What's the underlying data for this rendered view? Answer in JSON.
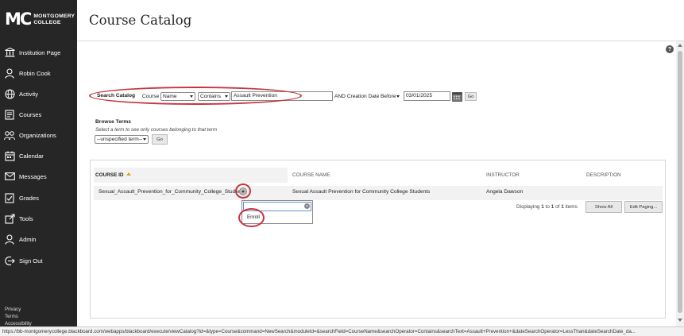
{
  "sidebar": {
    "logo_mark": "MC",
    "logo_line1": "MONTGOMERY",
    "logo_line2": "COLLEGE",
    "items": [
      {
        "label": "Institution Page",
        "icon": "institution-icon"
      },
      {
        "label": "Robin Cook",
        "icon": "user-icon"
      },
      {
        "label": "Activity",
        "icon": "globe-icon"
      },
      {
        "label": "Courses",
        "icon": "courses-icon"
      },
      {
        "label": "Organizations",
        "icon": "organizations-icon"
      },
      {
        "label": "Calendar",
        "icon": "calendar-icon"
      },
      {
        "label": "Messages",
        "icon": "envelope-icon"
      },
      {
        "label": "Grades",
        "icon": "grades-icon"
      },
      {
        "label": "Tools",
        "icon": "tools-icon"
      },
      {
        "label": "Admin",
        "icon": "admin-icon"
      },
      {
        "label": "Sign Out",
        "icon": "sign-out-icon"
      }
    ],
    "footer": [
      "Privacy",
      "Terms",
      "Accessibility"
    ]
  },
  "page": {
    "title": "Course Catalog",
    "help_glyph": "?"
  },
  "search": {
    "label": "Search Catalog",
    "scope": "Course",
    "field": "Name",
    "operator": "Contains",
    "text": "Assault Prevention",
    "date_label": "AND Creation Date",
    "date_operator": "Before",
    "date": "03/01/2025",
    "go": "Go"
  },
  "browse": {
    "title": "Browse Terms",
    "hint": "Select a term to see only courses belonging to that term",
    "term": "--unspecified term--",
    "go": "Go"
  },
  "results": {
    "headers": {
      "course_id": "COURSE ID",
      "course_name": "COURSE NAME",
      "instructor": "INSTRUCTOR",
      "description": "DESCRIPTION"
    },
    "rows": [
      {
        "course_id": "Sexual_Assault_Prevention_for_Community_College_Students",
        "course_name": "Sexual Assault Prevention for Community College Students",
        "instructor": "Angela Dawson",
        "description": ""
      }
    ],
    "menu": {
      "enroll": "Enroll"
    },
    "paging": {
      "prefix": "Displaying",
      "from": "1",
      "to_word": "to",
      "to": "1",
      "of_word": "of",
      "total": "1",
      "suffix": "items"
    },
    "show_all": "Show All",
    "edit_paging": "Edit Paging..."
  },
  "status_url": "https://bb-montgomerycollege.blackboard.com/webapps/blackboard/execute/viewCatalog?id=&type=Course&command=NewSearch&moduleId=&searchField=CourseName&searchOperator=Contains&searchText=Assault+Prevention+&dateSearchOperator=LessThan&dateSearchDate_da..."
}
